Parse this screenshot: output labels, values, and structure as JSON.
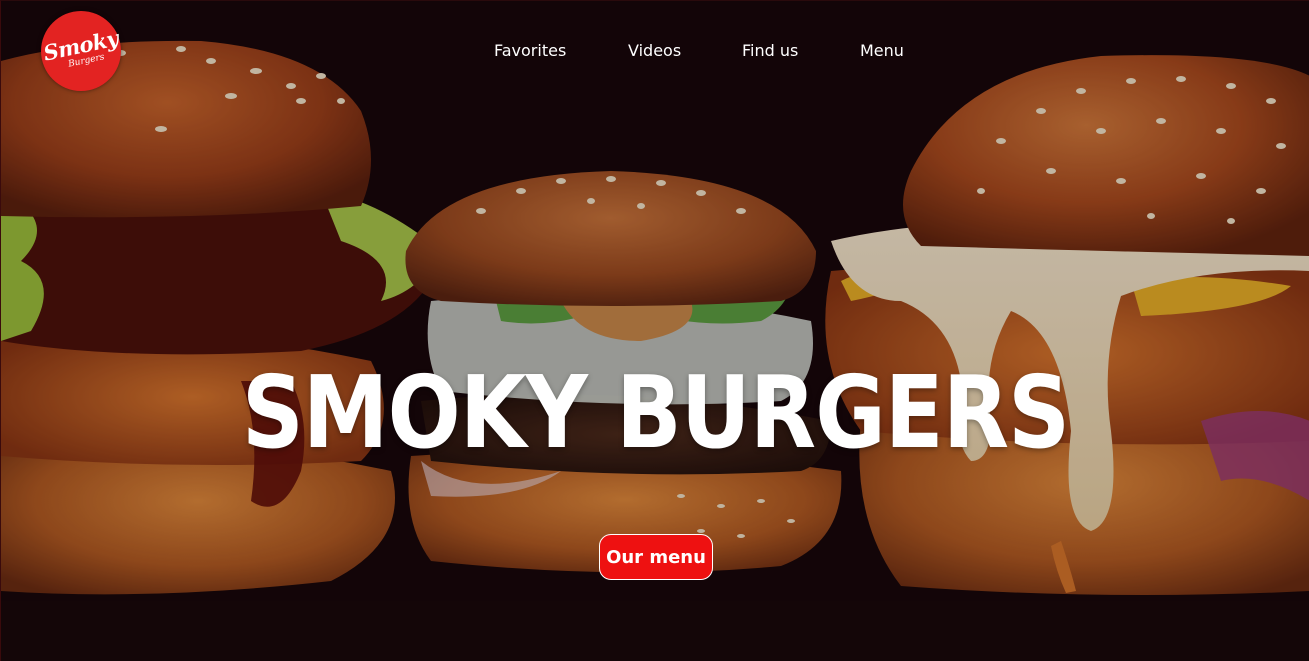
{
  "logo": {
    "main_text": "Smoky",
    "sub_text": "Burgers",
    "color": "#e32322"
  },
  "nav": {
    "items": [
      {
        "label": "Favorites"
      },
      {
        "label": "Videos"
      },
      {
        "label": "Find us"
      },
      {
        "label": "Menu"
      }
    ]
  },
  "hero": {
    "title": "SMOKY BURGERS",
    "cta_label": "Our menu",
    "cta_color": "#ee1111",
    "background_color": "#140608"
  }
}
